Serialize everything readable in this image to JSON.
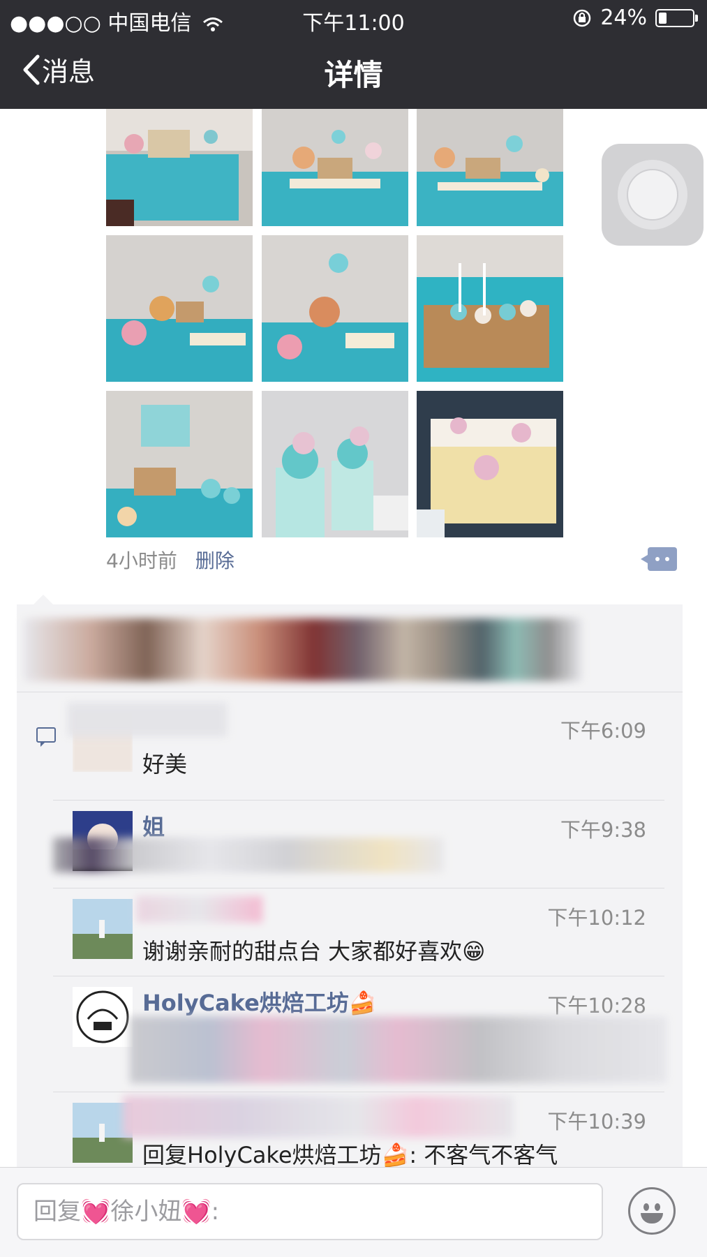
{
  "status_bar": {
    "carrier": "●●●○○ 中国电信",
    "time": "下午11:00",
    "battery_percent": "24%",
    "battery_level": 0.24
  },
  "nav": {
    "back_label": "消息",
    "title": "详情"
  },
  "post": {
    "photos": [
      {
        "caption": "",
        "theme": "teal-dessert-table"
      },
      {
        "caption": "",
        "theme": "teal-dessert-table"
      },
      {
        "caption": "",
        "theme": "teal-dessert-table"
      },
      {
        "caption": "",
        "theme": "teal-dessert-table"
      },
      {
        "caption": "",
        "theme": "teal-dessert-table"
      },
      {
        "caption": "",
        "theme": "cake-pops-wood-tray"
      },
      {
        "caption": "",
        "theme": "tiered-dessert-stand"
      },
      {
        "caption": "",
        "theme": "mousse-cups"
      },
      {
        "caption": "",
        "theme": "pudding-boxes"
      }
    ],
    "time_ago": "4小时前",
    "delete_label": "删除"
  },
  "comments": [
    {
      "name": "",
      "time": "下午6:09",
      "text": "好美"
    },
    {
      "name": "姐",
      "time": "下午9:38",
      "text": ""
    },
    {
      "name": "",
      "time": "下午10:12",
      "text": "谢谢亲耐的甜点台 大家都好喜欢😁"
    },
    {
      "name": "HolyCake烘焙工坊🍰",
      "time": "下午10:28",
      "text": ""
    },
    {
      "name": "",
      "time": "下午10:39",
      "text": "回复HolyCake烘焙工坊🍰: 不客气不客气"
    }
  ],
  "reply_box": {
    "placeholder": "回复💓徐小妞💓:"
  },
  "colors": {
    "nav_bg": "#2e2e33",
    "link": "#576b95",
    "panel_bg": "#f3f3f5",
    "meta_gray": "#8b8b8b"
  },
  "icons": [
    "back-chevron-icon",
    "wifi-icon",
    "rotation-lock-icon",
    "battery-icon",
    "comment-action-icon",
    "comment-bubble-icon",
    "emoji-icon",
    "assistive-touch-icon"
  ]
}
